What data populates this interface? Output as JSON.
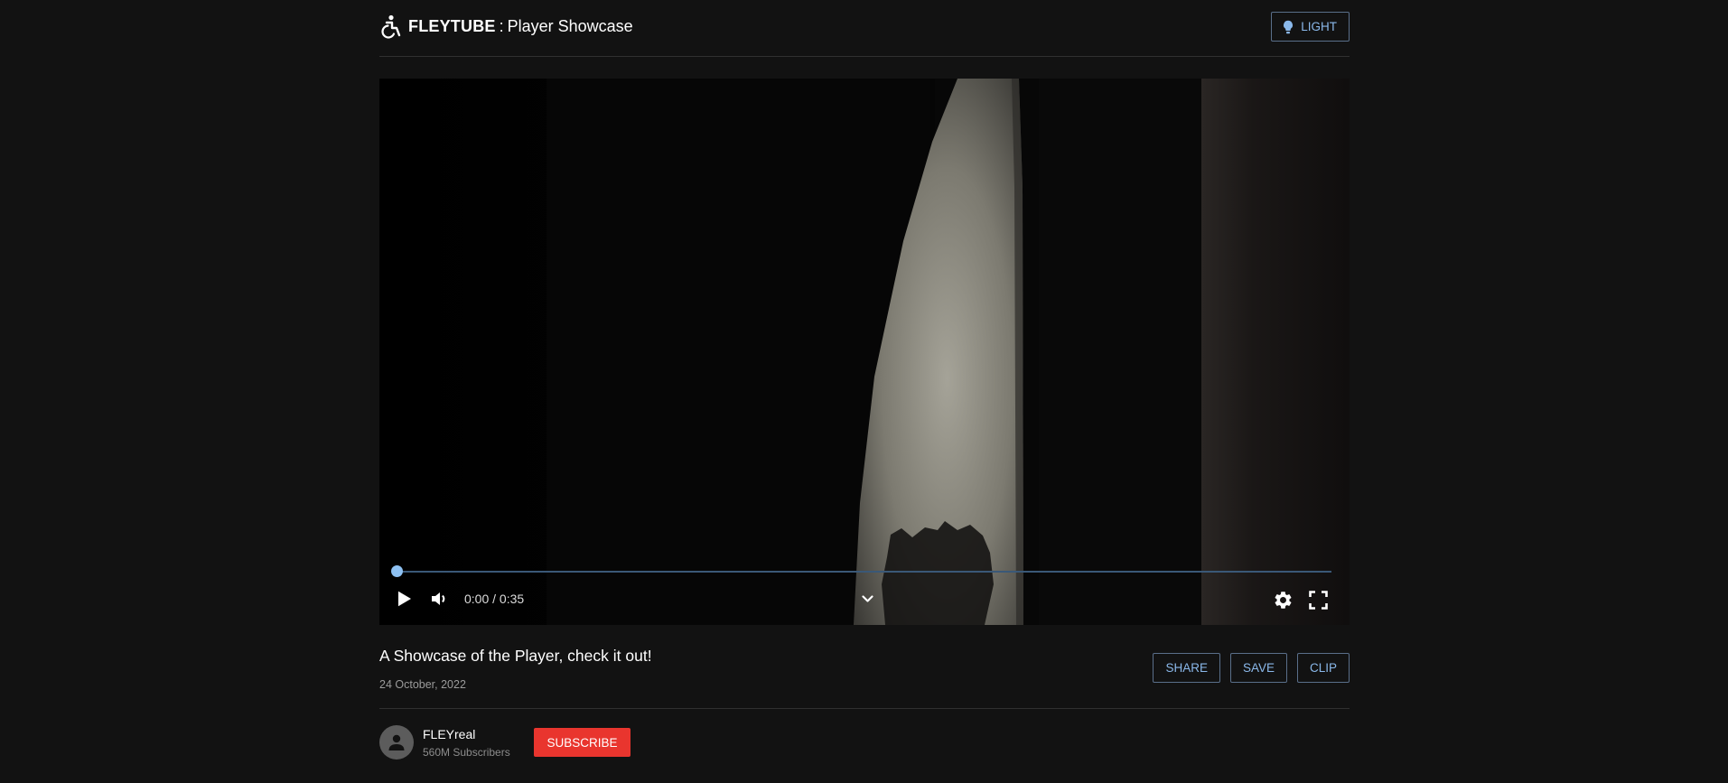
{
  "header": {
    "brand_name": "FLEYTUBE",
    "separator": ":",
    "subtitle": "Player Showcase",
    "theme_button_label": "LIGHT",
    "brand_icon": "accessibility-icon",
    "theme_icon": "lightbulb-icon"
  },
  "player": {
    "time_display": "0:00 / 0:35",
    "progress_fraction": 0,
    "icons": [
      "play-icon",
      "volume-icon",
      "chevron-down-icon",
      "settings-icon",
      "fullscreen-icon"
    ]
  },
  "video": {
    "title": "A Showcase of the Player, check it out!",
    "date": "24 October, 2022",
    "actions": [
      "SHARE",
      "SAVE",
      "CLIP"
    ]
  },
  "channel": {
    "name": "FLEYreal",
    "subscribers": "560M Subscribers",
    "subscribe_label": "SUBSCRIBE"
  },
  "colors": {
    "background": "#121212",
    "accent": "#8ab8ea",
    "subscribe": "#e9352e",
    "progress_knob": "#8ec1f2"
  }
}
